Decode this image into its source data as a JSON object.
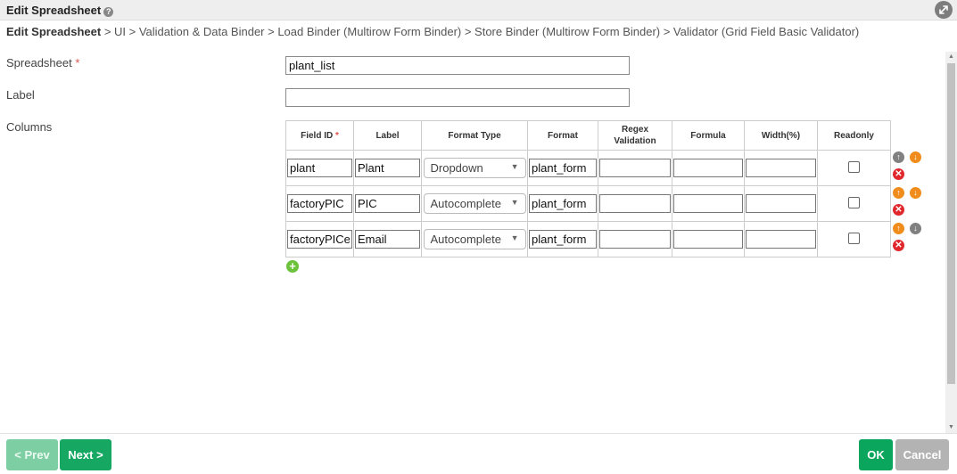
{
  "window": {
    "title": "Edit Spreadsheet",
    "help_glyph": "?",
    "expand_icon": "expand-icon"
  },
  "breadcrumb": {
    "first": "Edit Spreadsheet",
    "rest": " > UI > Validation & Data Binder > Load Binder (Multirow Form Binder) > Store Binder (Multirow Form Binder) > Validator (Grid Field Basic Validator)"
  },
  "form": {
    "spreadsheet_label": "Spreadsheet",
    "required_mark": "*",
    "spreadsheet_value": "plant_list",
    "label_label": "Label",
    "label_value": "",
    "columns_label": "Columns"
  },
  "grid": {
    "headers": {
      "field_id": "Field ID",
      "label": "Label",
      "format_type": "Format Type",
      "format": "Format",
      "regex_line1": "Regex",
      "regex_line2": "Validation",
      "formula": "Formula",
      "width": "Width(%)",
      "readonly": "Readonly"
    },
    "rows": [
      {
        "field_id": "plant",
        "label": "Plant",
        "format_type": "Dropdown",
        "format": "plant_form",
        "regex": "",
        "formula": "",
        "width": "",
        "readonly": false
      },
      {
        "field_id": "factoryPIC",
        "label": "PIC",
        "format_type": "Autocomplete",
        "format": "plant_form",
        "regex": "",
        "formula": "",
        "width": "",
        "readonly": false
      },
      {
        "field_id": "factoryPICe",
        "label": "Email",
        "format_type": "Autocomplete",
        "format": "plant_form",
        "regex": "",
        "formula": "",
        "width": "",
        "readonly": false
      }
    ]
  },
  "icons": {
    "up": "↑",
    "down": "↓",
    "delete": "✕",
    "add": "+",
    "caret": "▼",
    "scroll_up": "▲",
    "scroll_down": "▼"
  },
  "colors": {
    "ok_green": "#0aa65d",
    "next_green": "#16a862",
    "prev_disabled_green": "#7dcfa3",
    "cancel_grey": "#b3b3b3",
    "move_orange": "#f08c1c",
    "delete_red": "#e0282c",
    "add_green": "#6cc23a"
  },
  "footer": {
    "prev_label": "< Prev",
    "next_label": "Next >",
    "ok_label": "OK",
    "cancel_label": "Cancel"
  }
}
